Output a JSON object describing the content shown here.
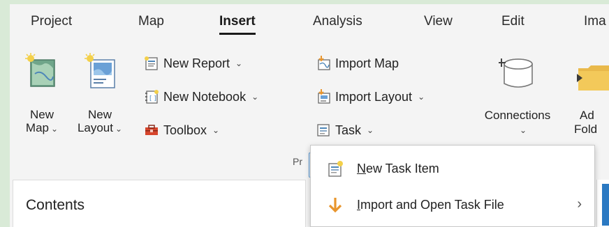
{
  "tabs": [
    {
      "label": "Project"
    },
    {
      "label": "Map"
    },
    {
      "label": "Insert"
    },
    {
      "label": "Analysis"
    },
    {
      "label": "View"
    },
    {
      "label": "Edit"
    },
    {
      "label": "Ima"
    }
  ],
  "ribbon": {
    "new_map": {
      "line1": "New",
      "line2": "Map",
      "caret": "⌄"
    },
    "new_layout": {
      "line1": "New",
      "line2": "Layout",
      "caret": "⌄"
    },
    "new_report": {
      "label": "New Report",
      "caret": "⌄"
    },
    "new_notebook": {
      "label": "New Notebook",
      "caret": "⌄"
    },
    "toolbox": {
      "label": "Toolbox",
      "caret": "⌄"
    },
    "import_map": {
      "label": "Import Map"
    },
    "import_layout": {
      "label": "Import Layout",
      "caret": "⌄"
    },
    "task": {
      "label": "Task",
      "caret": "⌄"
    },
    "connections": {
      "label": "Connections",
      "caret": "⌄"
    },
    "add_folder": {
      "line1": "Ad",
      "line2": "Fold"
    },
    "group_label": "Pr"
  },
  "dropdown": {
    "items": [
      {
        "label": "New Task Item",
        "underline": "N",
        "rest": "ew Task Item",
        "icon": "task-item-icon"
      },
      {
        "label": "Import and Open Task File",
        "underline": "I",
        "rest": "mport and Open Task File",
        "arrow": "›",
        "icon": "import-arrow-icon"
      }
    ]
  },
  "contents": {
    "title": "Contents"
  },
  "colors": {
    "accent": "#2b79c2",
    "tab_active": "#1a1a1a",
    "import_arrow": "#e8952d"
  }
}
